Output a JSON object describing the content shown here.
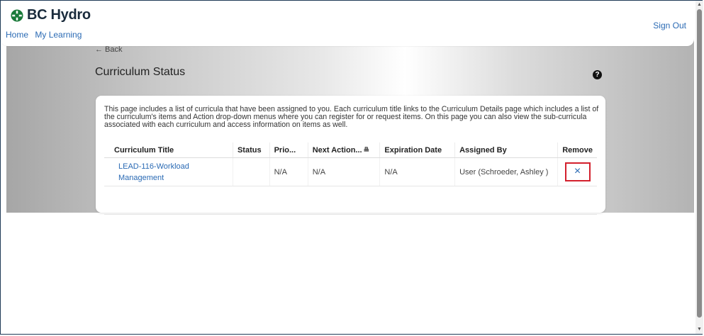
{
  "brand": {
    "logo_text": "BC Hydro",
    "accent": "#1a7a3a"
  },
  "nav": {
    "items": [
      "Home",
      "My Learning"
    ]
  },
  "header": {
    "sign_out": "Sign Out"
  },
  "page": {
    "back_label": "← Back",
    "title": "Curriculum Status",
    "help_glyph": "?",
    "description": "This page includes a list of curricula that have been assigned to you. Each curriculum title links to the Curriculum Details page which includes a list of the curriculum's items and Action drop-down menus where you can register for or request items. On this page you can also view the sub-curricula associated with each curriculum and access information on items as well."
  },
  "table": {
    "headers": [
      "Curriculum Title",
      "Status",
      "Prio...",
      "Next Action...",
      "Expiration Date",
      "Assigned By",
      "Remove"
    ],
    "rows": [
      {
        "title": "LEAD-116-Workload Management",
        "status": "",
        "priority": "N/A",
        "next_action": "N/A",
        "expiration": "N/A",
        "assigned_by": "User (Schroeder, Ashley )",
        "remove_glyph": "×"
      }
    ]
  }
}
